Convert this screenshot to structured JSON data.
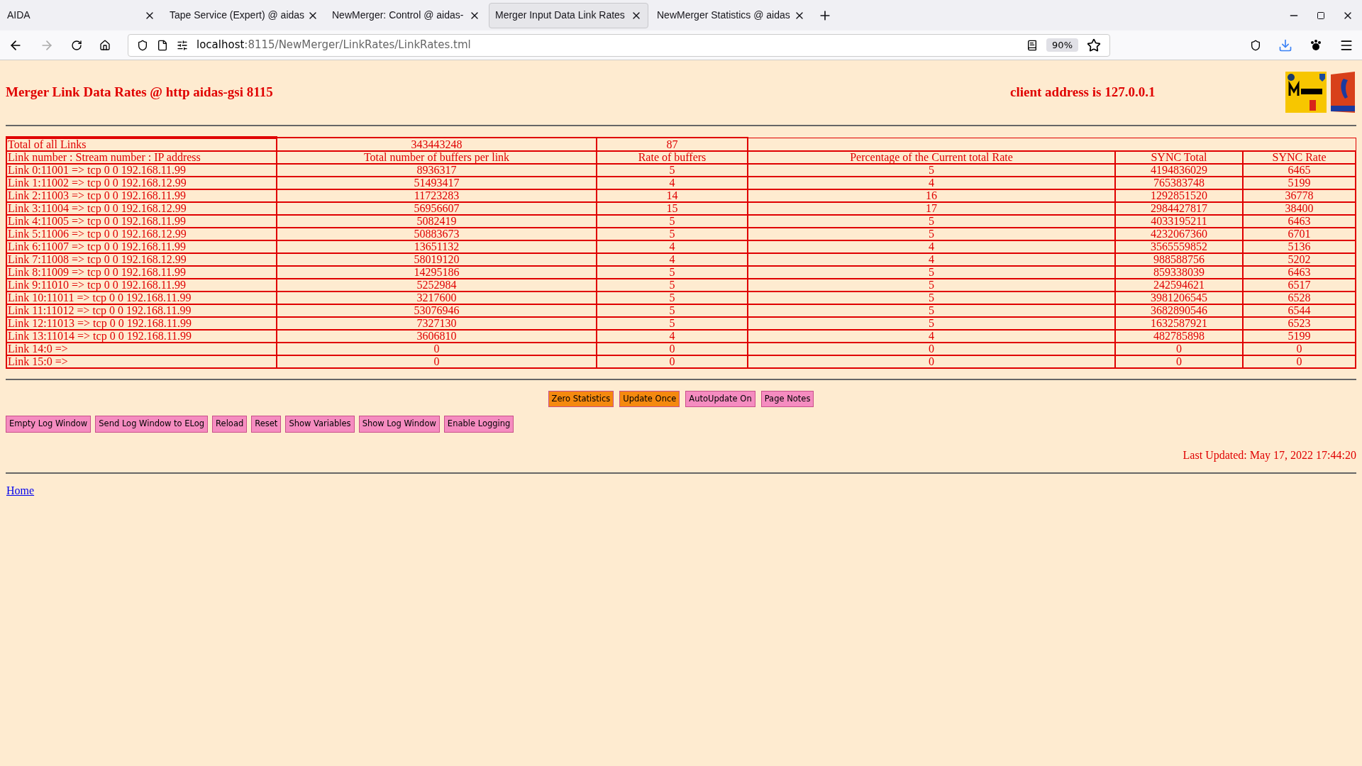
{
  "browser": {
    "tabs": [
      {
        "label": "AIDA",
        "selected": false
      },
      {
        "label": "Tape Service (Expert) @ aidas",
        "selected": false
      },
      {
        "label": "NewMerger: Control @ aidas-",
        "selected": false
      },
      {
        "label": "Merger Input Data Link Rates",
        "selected": true
      },
      {
        "label": "NewMerger Statistics @ aidas",
        "selected": false
      }
    ],
    "url_host": "localhost",
    "url_rest": ":8115/NewMerger/LinkRates/LinkRates.tml",
    "zoom": "90%"
  },
  "page": {
    "title": "Merger Link Data Rates @ http aidas-gsi 8115",
    "client": "client address is 127.0.0.1",
    "totals": {
      "label": "Total of all Links",
      "buffers": "343443248",
      "rate": "87"
    },
    "columns": [
      "Link number : Stream number : IP address",
      "Total number of buffers per link",
      "Rate of buffers",
      "Percentage of the Current total Rate",
      "SYNC Total",
      "SYNC Rate"
    ],
    "rows": [
      [
        "Link 0:11001 => tcp 0 0 192.168.11.99",
        "8936317",
        "5",
        "5",
        "4194836029",
        "6465"
      ],
      [
        "Link 1:11002 => tcp 0 0 192.168.12.99",
        "51493417",
        "4",
        "4",
        "765383748",
        "5199"
      ],
      [
        "Link 2:11003 => tcp 0 0 192.168.11.99",
        "11723283",
        "14",
        "16",
        "1292851520",
        "36778"
      ],
      [
        "Link 3:11004 => tcp 0 0 192.168.12.99",
        "56956607",
        "15",
        "17",
        "2984427817",
        "38400"
      ],
      [
        "Link 4:11005 => tcp 0 0 192.168.11.99",
        "5082419",
        "5",
        "5",
        "4033195211",
        "6463"
      ],
      [
        "Link 5:11006 => tcp 0 0 192.168.12.99",
        "50883673",
        "5",
        "5",
        "4232067360",
        "6701"
      ],
      [
        "Link 6:11007 => tcp 0 0 192.168.11.99",
        "13651132",
        "4",
        "4",
        "3565559852",
        "5136"
      ],
      [
        "Link 7:11008 => tcp 0 0 192.168.12.99",
        "58019120",
        "4",
        "4",
        "988588756",
        "5202"
      ],
      [
        "Link 8:11009 => tcp 0 0 192.168.11.99",
        "14295186",
        "5",
        "5",
        "859338039",
        "6463"
      ],
      [
        "Link 9:11010 => tcp 0 0 192.168.11.99",
        "5252984",
        "5",
        "5",
        "242594621",
        "6517"
      ],
      [
        "Link 10:11011 => tcp 0 0 192.168.11.99",
        "3217600",
        "5",
        "5",
        "3981206545",
        "6528"
      ],
      [
        "Link 11:11012 => tcp 0 0 192.168.11.99",
        "53076946",
        "5",
        "5",
        "3682890546",
        "6544"
      ],
      [
        "Link 12:11013 => tcp 0 0 192.168.11.99",
        "7327130",
        "5",
        "5",
        "1632587921",
        "6523"
      ],
      [
        "Link 13:11014 => tcp 0 0 192.168.11.99",
        "3606810",
        "4",
        "4",
        "482785898",
        "5199"
      ],
      [
        "Link 14:0 =>",
        "0",
        "0",
        "0",
        "0",
        "0"
      ],
      [
        "Link 15:0 =>",
        "0",
        "0",
        "0",
        "0",
        "0"
      ]
    ],
    "center_buttons": [
      {
        "label": "Zero Statistics",
        "color": "#f5890f"
      },
      {
        "label": "Update Once",
        "color": "#f5890f"
      },
      {
        "label": "AutoUpdate On",
        "color": "#f58cc0"
      },
      {
        "label": "Page Notes",
        "color": "#f58cc0"
      }
    ],
    "log_buttons": [
      {
        "label": "Empty Log Window",
        "color": "#f58cc0"
      },
      {
        "label": "Send Log Window to ELog",
        "color": "#f58cc0"
      },
      {
        "label": "Reload",
        "color": "#f58cc0"
      },
      {
        "label": "Reset",
        "color": "#f58cc0"
      },
      {
        "label": "Show Variables",
        "color": "#f58cc0"
      },
      {
        "label": "Show Log Window",
        "color": "#f58cc0"
      },
      {
        "label": "Enable Logging",
        "color": "#f58cc0"
      }
    ],
    "last_updated": "Last Updated: May 17, 2022 17:44:20",
    "home_link": "Home"
  }
}
